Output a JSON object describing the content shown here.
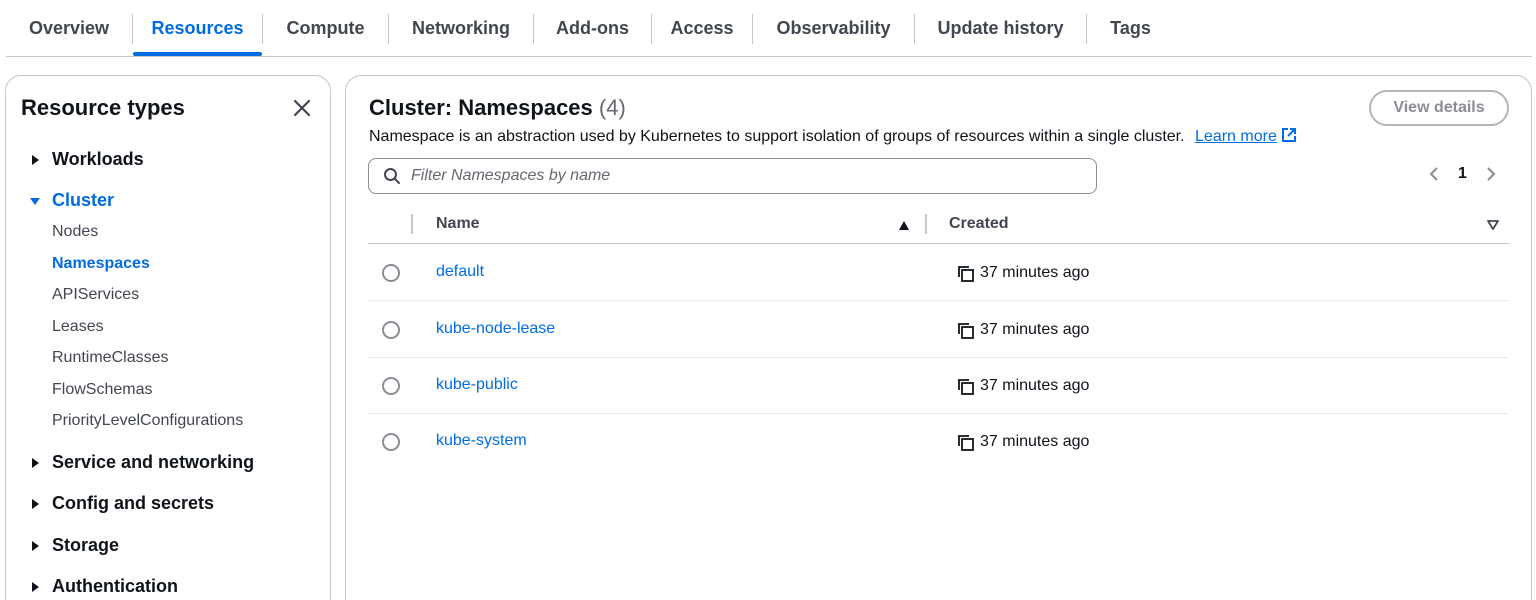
{
  "tabs": [
    {
      "label": "Overview"
    },
    {
      "label": "Resources"
    },
    {
      "label": "Compute"
    },
    {
      "label": "Networking"
    },
    {
      "label": "Add-ons"
    },
    {
      "label": "Access"
    },
    {
      "label": "Observability"
    },
    {
      "label": "Update history"
    },
    {
      "label": "Tags"
    }
  ],
  "active_tab": "Resources",
  "sidebar": {
    "title": "Resource types",
    "groups": [
      {
        "label": "Workloads",
        "expanded": false
      },
      {
        "label": "Cluster",
        "expanded": true,
        "items": [
          {
            "label": "Nodes"
          },
          {
            "label": "Namespaces",
            "active": true
          },
          {
            "label": "APIServices"
          },
          {
            "label": "Leases"
          },
          {
            "label": "RuntimeClasses"
          },
          {
            "label": "FlowSchemas"
          },
          {
            "label": "PriorityLevelConfigurations"
          }
        ]
      },
      {
        "label": "Service and networking",
        "expanded": false
      },
      {
        "label": "Config and secrets",
        "expanded": false
      },
      {
        "label": "Storage",
        "expanded": false
      },
      {
        "label": "Authentication",
        "expanded": false
      }
    ]
  },
  "main": {
    "title": "Cluster: Namespaces",
    "count": "(4)",
    "view_details_label": "View details",
    "description": "Namespace is an abstraction used by Kubernetes to support isolation of groups of resources within a single cluster.",
    "learn_more_label": "Learn more",
    "filter_placeholder": "Filter Namespaces by name",
    "page": "1",
    "columns": {
      "name": "Name",
      "created": "Created"
    },
    "rows": [
      {
        "name": "default",
        "created": "37 minutes ago"
      },
      {
        "name": "kube-node-lease",
        "created": "37 minutes ago"
      },
      {
        "name": "kube-public",
        "created": "37 minutes ago"
      },
      {
        "name": "kube-system",
        "created": "37 minutes ago"
      }
    ]
  },
  "colors": {
    "accent": "#006ce0",
    "text": "#0f141a",
    "muted": "#424650",
    "border": "#c6c6cd"
  },
  "icons": {
    "close": "close-icon",
    "caret_right": "caret-right-icon",
    "caret_down": "caret-down-icon",
    "search": "search-icon",
    "external": "external-link-icon",
    "copy": "copy-icon",
    "sort_asc": "sort-ascending-icon",
    "sort_desc": "sort-descending-icon"
  }
}
